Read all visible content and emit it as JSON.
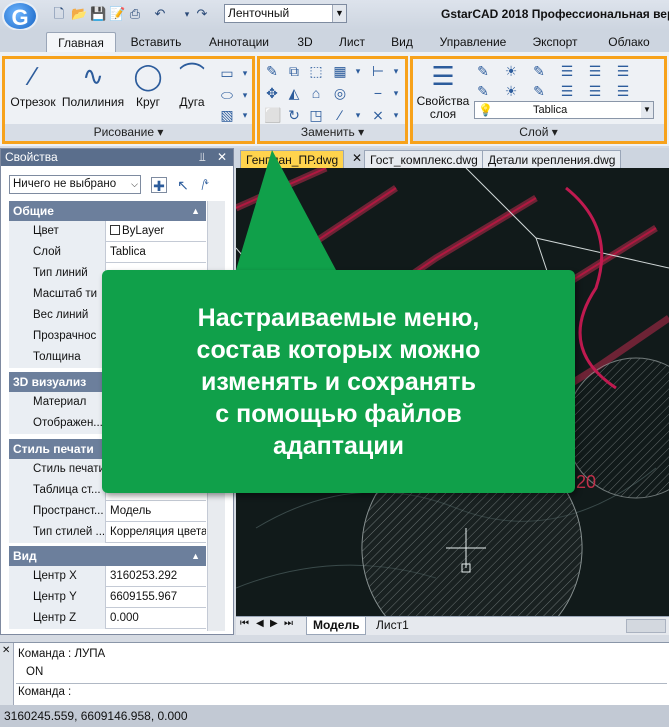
{
  "app": {
    "logo_letter": "G",
    "title": "GstarCAD 2018 Профессиональная версия",
    "workspace": "Ленточный"
  },
  "tabs": [
    "Главная",
    "Вставить",
    "Аннотации",
    "3D",
    "Лист",
    "Вид",
    "Управление",
    "Экспорт",
    "Облако"
  ],
  "ribbon": {
    "draw": {
      "label": "Рисование",
      "buttons": [
        "Отрезок",
        "Полилиния",
        "Круг",
        "Дуга"
      ]
    },
    "modify": {
      "label": "Заменить"
    },
    "layer": {
      "label": "Слой",
      "props_button_line1": "Свойства",
      "props_button_line2": "слоя",
      "current_layer": "Tablica"
    }
  },
  "properties": {
    "title": "Свойства",
    "selection": "Ничего не выбрано",
    "sections": [
      {
        "title": "Общие",
        "rows": [
          {
            "key": "Цвет",
            "value": "ByLayer"
          },
          {
            "key": "Слой",
            "value": "Tablica"
          },
          {
            "key": "Тип линий",
            "value": ""
          },
          {
            "key": "Масштаб ти",
            "value": ""
          },
          {
            "key": "Вес линий",
            "value": ""
          },
          {
            "key": "Прозрачнос",
            "value": ""
          },
          {
            "key": "Толщина",
            "value": ""
          }
        ]
      },
      {
        "title": "3D визуализ",
        "rows": [
          {
            "key": "Материал",
            "value": ""
          },
          {
            "key": "Отображен...",
            "value": ""
          }
        ]
      },
      {
        "title": "Стиль печати",
        "rows": [
          {
            "key": "Стиль печати",
            "value": ""
          },
          {
            "key": "Таблица ст...",
            "value": ""
          },
          {
            "key": "Пространст...",
            "value": "Модель"
          },
          {
            "key": "Тип стилей ...",
            "value": "Корреляция цвета"
          }
        ]
      },
      {
        "title": "Вид",
        "rows": [
          {
            "key": "Центр X",
            "value": "3160253.292"
          },
          {
            "key": "Центр Y",
            "value": "6609155.967"
          },
          {
            "key": "Центр Z",
            "value": "0.000"
          }
        ]
      }
    ]
  },
  "documents": [
    "Генплан_ПР.dwg",
    "Гост_комплекс.dwg",
    "Детали крепления.dwg"
  ],
  "canvas_text": {
    "number": "20"
  },
  "layouts": [
    "Модель",
    "Лист1"
  ],
  "command": {
    "line1": "Команда : ЛУПА",
    "line2": "ON",
    "prompt": "Команда :"
  },
  "status_coords": "3160245.559, 6609146.958, 0.000",
  "callout": "Настраиваемые меню,\nсостав которых можно\nизменять и сохранять\nс помощью файлов\nадаптации",
  "colors": {
    "accent": "#f7a21b",
    "callout": "#10a04a",
    "active_doc_tab": "#ffd34d"
  }
}
